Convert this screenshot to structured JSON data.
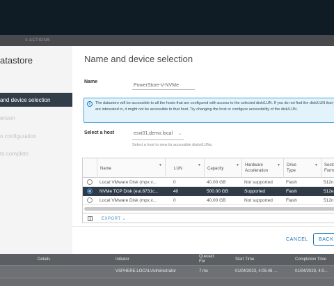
{
  "background": {
    "action_label": "≡ ACTIONS",
    "table_headers": [
      "Details",
      "Initiator",
      "Queued For",
      "Start Time",
      "Completion Time"
    ],
    "row": {
      "initiator": "VSPHERE.LOCAL\\Administrator",
      "queued_for": "7 ms",
      "start_time": "01/04/2023, 4:05:48 ...",
      "completion_time": "01/04/2023, 4:0..."
    }
  },
  "wizard": {
    "title": "atastore",
    "steps": [
      {
        "label": "and device selection",
        "active": true
      },
      {
        "label": "ersion",
        "active": false
      },
      {
        "label": "n configuration",
        "active": false
      },
      {
        "label": "to complete",
        "active": false
      }
    ]
  },
  "page": {
    "title": "Name and device selection",
    "name_label": "Name",
    "name_value": "PowerStore-V-NVMe",
    "info_text": "The datastore will be accessible to all the hosts that are configured with access to the selected disk/LUN. If you do not find the disk/LUN that you are interested in, it might not be accessible to that host. Try changing the host or configure accessibility of the disk/LUN.",
    "host_label": "Select a host",
    "host_value": "esxi01.demo.local",
    "host_helper": "Select a host to view its accessible disks/LUNs."
  },
  "grid": {
    "columns": [
      "Name",
      "LUN",
      "Capacity",
      "Hardware Acceleration",
      "Drive Type",
      "Secto Forma"
    ],
    "rows": [
      {
        "name": "Local VMware Disk (mpx.v...",
        "lun": "0",
        "capacity": "40.00 GB",
        "hw": "Not supported",
        "drive": "Flash",
        "sector": "512n",
        "selected": false
      },
      {
        "name": "NVMe TCP Disk (eui.8731c...",
        "lun": "40",
        "capacity": "500.00 GB",
        "hw": "Supported",
        "drive": "Flash",
        "sector": "512e",
        "selected": true
      },
      {
        "name": "Local VMware Disk (mpx.v...",
        "lun": "0",
        "capacity": "40.00 GB",
        "hw": "Not supported",
        "drive": "Flash",
        "sector": "512n",
        "selected": false
      }
    ],
    "export_label": "EXPORT ⌄"
  },
  "footer": {
    "cancel_label": "CANCEL",
    "back_label": "BACK"
  },
  "colors": {
    "accent": "#1b74b8",
    "selected_row": "#2f3c47",
    "topbar": "#0f1c26"
  }
}
